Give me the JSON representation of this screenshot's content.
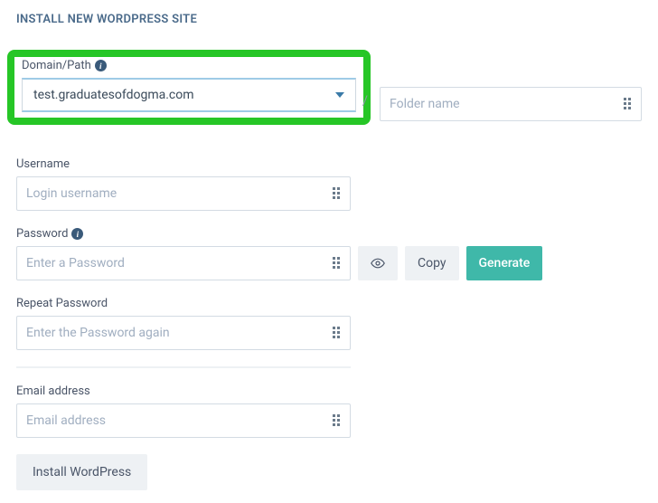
{
  "title": "INSTALL NEW WORDPRESS SITE",
  "domainPath": {
    "label": "Domain/Path",
    "selected": "test.graduatesofdogma.com",
    "folder_placeholder": "Folder name"
  },
  "username": {
    "label": "Username",
    "placeholder": "Login username"
  },
  "password": {
    "label": "Password",
    "placeholder": "Enter a Password",
    "eye_label": "Show",
    "copy_label": "Copy",
    "generate_label": "Generate"
  },
  "repeatPassword": {
    "label": "Repeat Password",
    "placeholder": "Enter the Password again"
  },
  "email": {
    "label": "Email address",
    "placeholder": "Email address"
  },
  "install_label": "Install WordPress"
}
